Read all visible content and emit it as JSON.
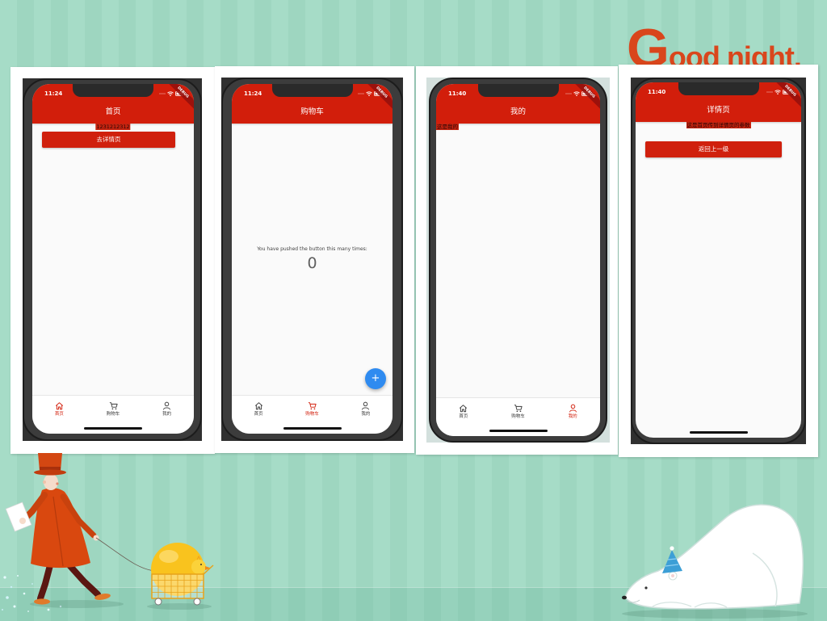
{
  "colors": {
    "background_stripe_a": "#a6dcc7",
    "background_stripe_b": "#9ed6c0",
    "app_bar_red": "#d21e0b",
    "button_red": "#d0200d",
    "active_nav": "#d21e0b",
    "fab_blue": "#2f8bf0",
    "greeting_orange": "#d9461c"
  },
  "greeting": "Good night.",
  "phones": [
    {
      "status_time": "11:24",
      "debug_banner": "DEBUG",
      "app_bar_title": "首页",
      "body_label": "1231212312",
      "primary_button": "去详情页",
      "nav": [
        {
          "label": "首页",
          "icon": "home-icon",
          "active": true
        },
        {
          "label": "购物车",
          "icon": "cart-icon",
          "active": false
        },
        {
          "label": "我的",
          "icon": "person-icon",
          "active": false
        }
      ]
    },
    {
      "status_time": "11:24",
      "debug_banner": "DEBUG",
      "app_bar_title": "购物车",
      "counter_caption": "You have pushed the button this many times:",
      "counter_value": "0",
      "fab_label": "+",
      "nav": [
        {
          "label": "首页",
          "icon": "home-icon",
          "active": false
        },
        {
          "label": "购物车",
          "icon": "cart-icon",
          "active": true
        },
        {
          "label": "我的",
          "icon": "person-icon",
          "active": false
        }
      ]
    },
    {
      "status_time": "11:40",
      "debug_banner": "DEBUG",
      "app_bar_title": "我的",
      "body_label": "这是我的",
      "nav": [
        {
          "label": "首页",
          "icon": "home-icon",
          "active": false
        },
        {
          "label": "购物车",
          "icon": "cart-icon",
          "active": false
        },
        {
          "label": "我的",
          "icon": "person-icon",
          "active": true
        }
      ]
    },
    {
      "status_time": "11:40",
      "debug_banner": "DEBUG",
      "app_bar_title": "详情页",
      "body_label": "这是首页传到详情页的参数",
      "primary_button": "返回上一级"
    }
  ]
}
